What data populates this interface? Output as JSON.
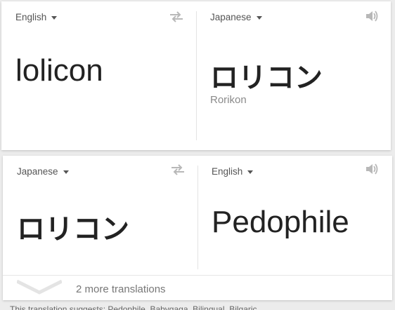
{
  "top_card": {
    "source_lang": "English",
    "target_lang": "Japanese",
    "source_text": "lolicon",
    "target_text": "ロリコン",
    "romanization": "Rorikon"
  },
  "bottom_card": {
    "source_lang": "Japanese",
    "target_lang": "English",
    "source_text": "ロリコン",
    "target_text": "Pedophile",
    "more_translations": "2 more translations"
  },
  "footer_text": "This translation suggests: Pedophile, Babygaga, Bilingual, Bilgaric",
  "icons": [
    "chevron-down-icon",
    "swap-icon",
    "speaker-icon",
    "expand-chevron-icon"
  ],
  "colors": {
    "card": "#ffffff",
    "background": "#ececec",
    "text": "#222222",
    "muted": "#8a8a8a"
  }
}
